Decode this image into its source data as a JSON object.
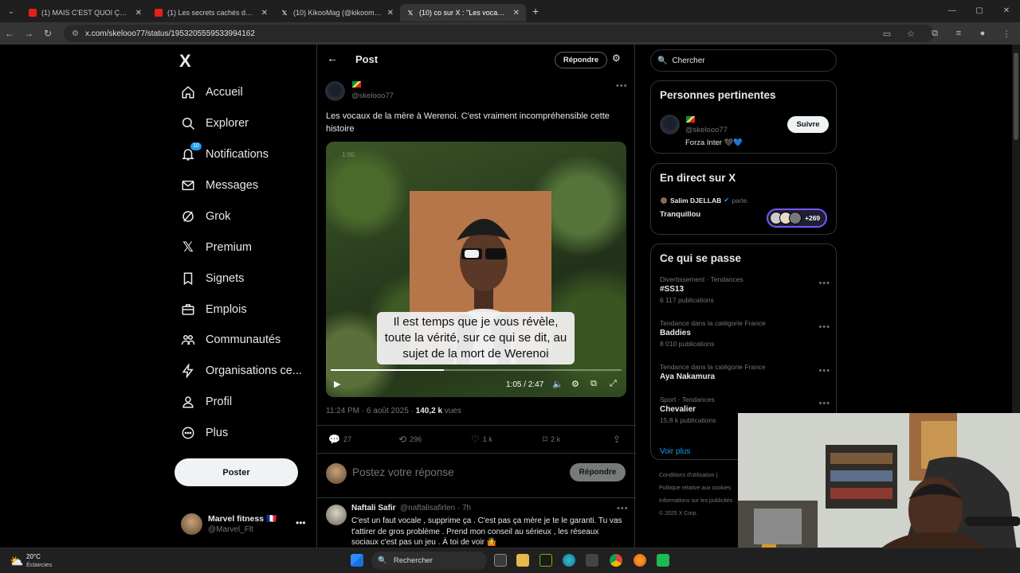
{
  "browser": {
    "tabs": [
      {
        "title": "(1) MAIS C'EST QUOI ÇA ? LES",
        "icon": "youtube-icon",
        "active": false
      },
      {
        "title": "(1) Les secrets cachés du SEXTO",
        "icon": "youtube-icon",
        "active": false
      },
      {
        "title": "(10) KikooMag (@kikoomag) /",
        "icon": "x-icon",
        "active": false
      },
      {
        "title": "(10) co sur X : \"Les vocaux de la",
        "icon": "x-icon",
        "active": true
      }
    ],
    "url": "x.com/skelooo77/status/1953205559533994162"
  },
  "nav": {
    "logo": "X",
    "notification_badge": "10",
    "items": [
      {
        "label": "Accueil",
        "icon": "home-icon"
      },
      {
        "label": "Explorer",
        "icon": "search-icon"
      },
      {
        "label": "Notifications",
        "icon": "bell-icon"
      },
      {
        "label": "Messages",
        "icon": "mail-icon"
      },
      {
        "label": "Grok",
        "icon": "grok-icon"
      },
      {
        "label": "Premium",
        "icon": "x-premium-icon"
      },
      {
        "label": "Signets",
        "icon": "bookmark-icon"
      },
      {
        "label": "Emplois",
        "icon": "briefcase-icon"
      },
      {
        "label": "Communautés",
        "icon": "people-icon"
      },
      {
        "label": "Organisations ce...",
        "icon": "lightning-icon"
      },
      {
        "label": "Profil",
        "icon": "person-icon"
      },
      {
        "label": "Plus",
        "icon": "more-circle-icon"
      }
    ],
    "post_button": "Poster",
    "account": {
      "name": "Marvel fitness 🇫🇷",
      "handle": "@Marvel_Flt"
    }
  },
  "post": {
    "header_title": "Post",
    "reply_button": "Répondre",
    "author_handle": "@skelooo77",
    "text": "Les vocaux de la mère à Werenoi. C'est vraiment incompréhensible cette histoire",
    "video": {
      "watermark": "1:00",
      "subtitle": "Il est temps que je vous révèle, toute la vérité, sur ce qui se dit, au sujet de la mort de Werenoi",
      "time": "1:05 / 2:47",
      "progress": 0.39
    },
    "meta_time": "11:24 PM · 6 août 2025 · ",
    "meta_views_count": "140,2 k",
    "meta_views_label": " vues",
    "actions": {
      "replies": "27",
      "reposts": "296",
      "likes": "1 k",
      "bookmarks": "2 k"
    },
    "compose_placeholder": "Postez votre réponse",
    "compose_button": "Répondre",
    "reply": {
      "name": "Naftali Safir",
      "handle": "@naftalisafirlen · 7h",
      "text": "C'est un faut vocale , supprime ça . C'est pas ça mère je te le garanti. Tu vas t'attirer de gros problème . Prend mon conseil au sérieux , les réseaux sociaux c'est pas un jeu . À toi de voir 🤷"
    }
  },
  "sidebar": {
    "search_placeholder": "Chercher",
    "relevant": {
      "title": "Personnes pertinentes",
      "handle": "@skelooo77",
      "bio": "Forza Inter 🖤💙",
      "follow": "Suivre"
    },
    "live": {
      "title": "En direct sur X",
      "host": "Salim DJELLAB",
      "host_status": "parle.",
      "space_title": "Tranquillou",
      "listeners": "+269"
    },
    "trends": {
      "title": "Ce qui se passe",
      "items": [
        {
          "category": "Divertissement · Tendances",
          "name": "#SS13",
          "count": "6 117 publications"
        },
        {
          "category": "Tendance dans la catégorie France",
          "name": "Baddies",
          "count": "8 010 publications"
        },
        {
          "category": "Tendance dans la catégorie France",
          "name": "Aya Nakamura",
          "count": ""
        },
        {
          "category": "Sport · Tendances",
          "name": "Chevalier",
          "count": "15,8 k publications"
        }
      ],
      "more": "Voir plus"
    },
    "footer": [
      "Conditions d'utilisation |",
      "Politique relative aux cookies",
      "Informations sur les publicités",
      "© 2025 X Corp."
    ]
  },
  "taskbar": {
    "temperature": "20°C",
    "condition": "Éclaircies",
    "search": "Rechercher"
  },
  "colors": {
    "accent": "#1d9bf0",
    "background": "#000000",
    "border": "#2f3336",
    "muted": "#71767b"
  }
}
